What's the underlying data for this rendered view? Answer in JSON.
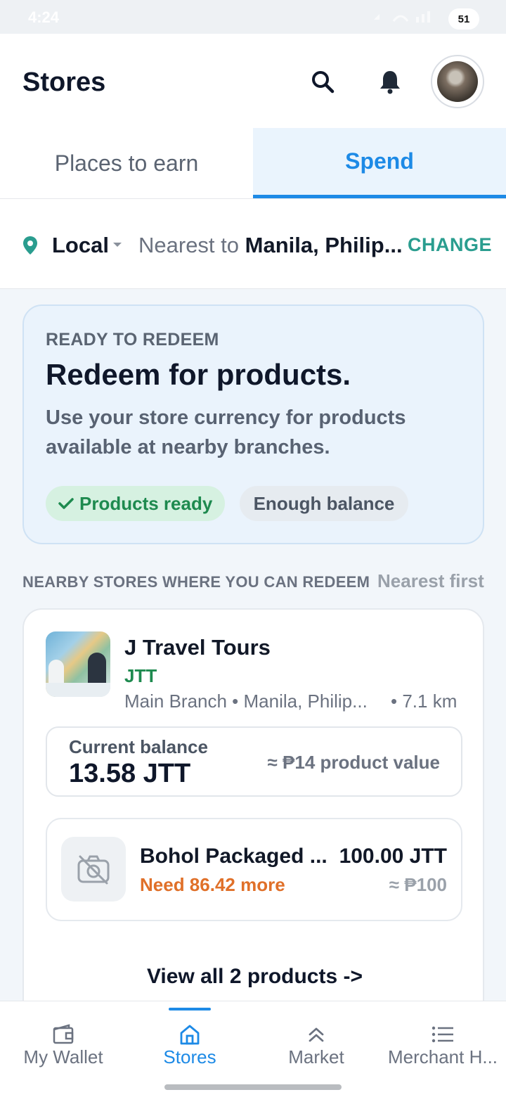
{
  "status_bar": {
    "time": "4:24",
    "battery": "51"
  },
  "header": {
    "title": "Stores",
    "icons": [
      "search-icon",
      "bell-icon"
    ]
  },
  "tabs": [
    {
      "label": "Places to earn",
      "active": false
    },
    {
      "label": "Spend",
      "active": true
    }
  ],
  "location": {
    "scope": "Local",
    "nearest_prefix": "Nearest to",
    "city": "Manila, Philip...",
    "change_label": "CHANGE"
  },
  "redeem_card": {
    "eyebrow": "READY TO REDEEM",
    "title": "Redeem for products.",
    "description": "Use your store currency for products available at nearby branches.",
    "chips": [
      "Products ready",
      "Enough balance"
    ]
  },
  "section": {
    "title": "NEARBY STORES WHERE YOU CAN REDEEM",
    "sort": "Nearest first"
  },
  "store": {
    "name": "J Travel Tours",
    "code": "JTT",
    "branch": "Main Branch • Manila, Philip...",
    "distance": "• 7.1 km",
    "balance_label": "Current balance",
    "balance_value": "13.58 JTT",
    "balance_approx": "≈ ₱14 product value",
    "product": {
      "name": "Bohol Packaged ...",
      "need": "Need 86.42 more",
      "price": "100.00 JTT",
      "approx": "≈ ₱100"
    },
    "view_all": "View all 2 products ->"
  },
  "bottom_nav": [
    {
      "label": "My Wallet",
      "icon": "wallet-icon"
    },
    {
      "label": "Stores",
      "icon": "store-icon",
      "active": true
    },
    {
      "label": "Market",
      "icon": "market-icon"
    },
    {
      "label": "Merchant H...",
      "icon": "list-icon"
    }
  ],
  "colors": {
    "accent": "#1d8ae6",
    "success": "#1e8a4f",
    "warning": "#e07029",
    "teal": "#2a9d8f"
  }
}
